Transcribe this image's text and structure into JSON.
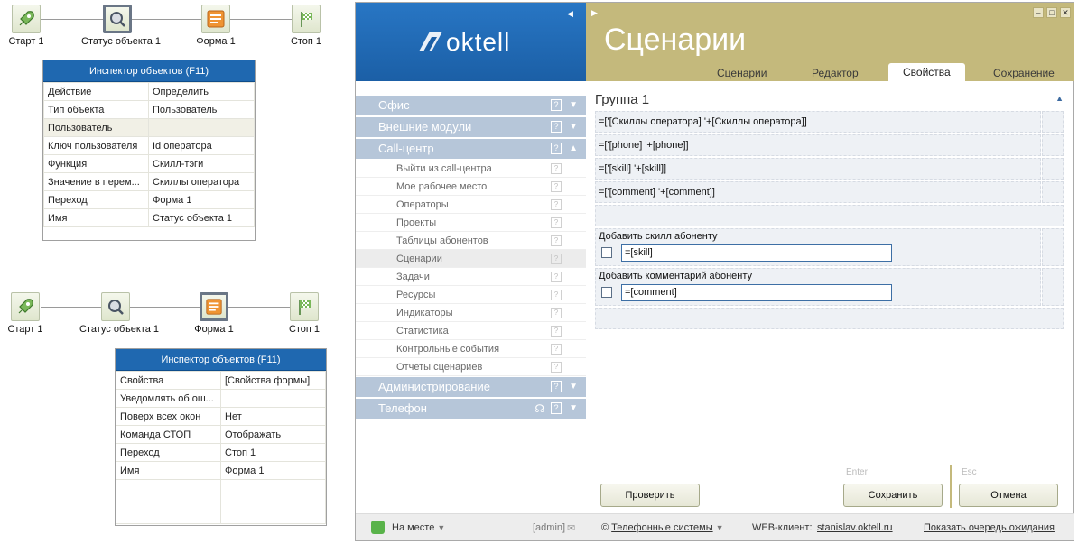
{
  "flow1": {
    "nodes": [
      "Старт 1",
      "Статус объекта 1",
      "Форма 1",
      "Стоп 1"
    ]
  },
  "inspector1": {
    "title": "Инспектор объектов (F11)",
    "rows": [
      {
        "k": "Действие",
        "v": "Определить"
      },
      {
        "k": "Тип объекта",
        "v": "Пользователь"
      },
      {
        "k": "Пользователь",
        "v": ""
      },
      {
        "k": "Ключ пользователя",
        "v": "Id оператора"
      },
      {
        "k": "Функция",
        "v": "Скилл-тэги"
      },
      {
        "k": "Значение в перем...",
        "v": "Скиллы оператора"
      },
      {
        "k": "Переход",
        "v": "Форма 1"
      },
      {
        "k": "Имя",
        "v": "Статус объекта 1"
      }
    ]
  },
  "flow2": {
    "nodes": [
      "Старт 1",
      "Статус объекта 1",
      "Форма 1",
      "Стоп 1"
    ]
  },
  "inspector2": {
    "title": "Инспектор объектов (F11)",
    "rows": [
      {
        "k": "Свойства",
        "v": "[Свойства формы]"
      },
      {
        "k": "Уведомлять об ош...",
        "v": ""
      },
      {
        "k": "Поверх всех окон",
        "v": "Нет"
      },
      {
        "k": "Команда СТОП",
        "v": "Отображать"
      },
      {
        "k": "Переход",
        "v": "Стоп 1"
      },
      {
        "k": "Имя",
        "v": "Форма 1"
      }
    ]
  },
  "app": {
    "logo": "oktell",
    "title": "Сценарии",
    "tabs": {
      "t1": "Сценарии",
      "t2": "Редактор",
      "t3": "Свойства",
      "t4": "Сохранение"
    },
    "menu": {
      "office": "Офис",
      "modules": "Внешние модули",
      "callcenter": "Call-центр",
      "items": [
        "Выйти из call-центра",
        "Мое рабочее место",
        "Операторы",
        "Проекты",
        "Таблицы абонентов",
        "Сценарии",
        "Задачи",
        "Ресурсы",
        "Индикаторы",
        "Статистика",
        "Контрольные события",
        "Отчеты сценариев"
      ],
      "admin": "Администрирование",
      "phone": "Телефон"
    },
    "group_title": "Группа 1",
    "rows": [
      "=['[Скиллы оператора] '+[Скиллы оператора]]",
      "=['[phone] '+[phone]]",
      "=['[skill] '+[skill]]",
      "=['[comment] '+[comment]]"
    ],
    "block1": {
      "label": "Добавить скилл абоненту",
      "value": "=[skill]"
    },
    "block2": {
      "label": "Добавить комментарий абоненту",
      "value": "=[comment]"
    },
    "buttons": {
      "check": "Проверить",
      "save": "Сохранить",
      "cancel": "Отмена"
    },
    "hints": {
      "enter": "Enter",
      "esc": "Esc"
    },
    "status": {
      "state": "На месте",
      "user": "[admin]",
      "company": "Телефонные системы",
      "web_label": "WEB-клиент:",
      "web_url": "stanislav.oktell.ru",
      "queue": "Показать очередь ожидания"
    }
  },
  "colors": {
    "brand_blue": "#1b5fa6",
    "header_olive": "#c4b97c",
    "menu_section": "#b6c6d9",
    "inspector_head": "#1f68b0",
    "status_green": "#59b34a"
  }
}
